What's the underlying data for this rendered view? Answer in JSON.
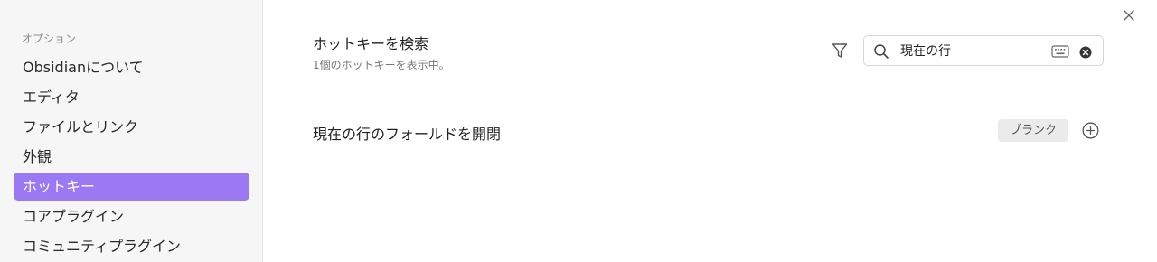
{
  "sidebar": {
    "heading": "オプション",
    "items": [
      {
        "label": "Obsidianについて",
        "active": false
      },
      {
        "label": "エディタ",
        "active": false
      },
      {
        "label": "ファイルとリンク",
        "active": false
      },
      {
        "label": "外観",
        "active": false
      },
      {
        "label": "ホットキー",
        "active": true
      },
      {
        "label": "コアプラグイン",
        "active": false
      },
      {
        "label": "コミュニティプラグイン",
        "active": false
      }
    ]
  },
  "header": {
    "title": "ホットキーを検索",
    "subtitle": "1個のホットキーを表示中。"
  },
  "search": {
    "value": "現在の行",
    "icons": [
      "filter-icon",
      "search-icon",
      "keyboard-icon",
      "clear-icon"
    ]
  },
  "hotkeys": [
    {
      "command": "現在の行のフォールドを開閉",
      "binding": "ブランク"
    }
  ],
  "colors": {
    "accent": "#9b79f2",
    "sidebar_bg": "#f6f6f6"
  }
}
